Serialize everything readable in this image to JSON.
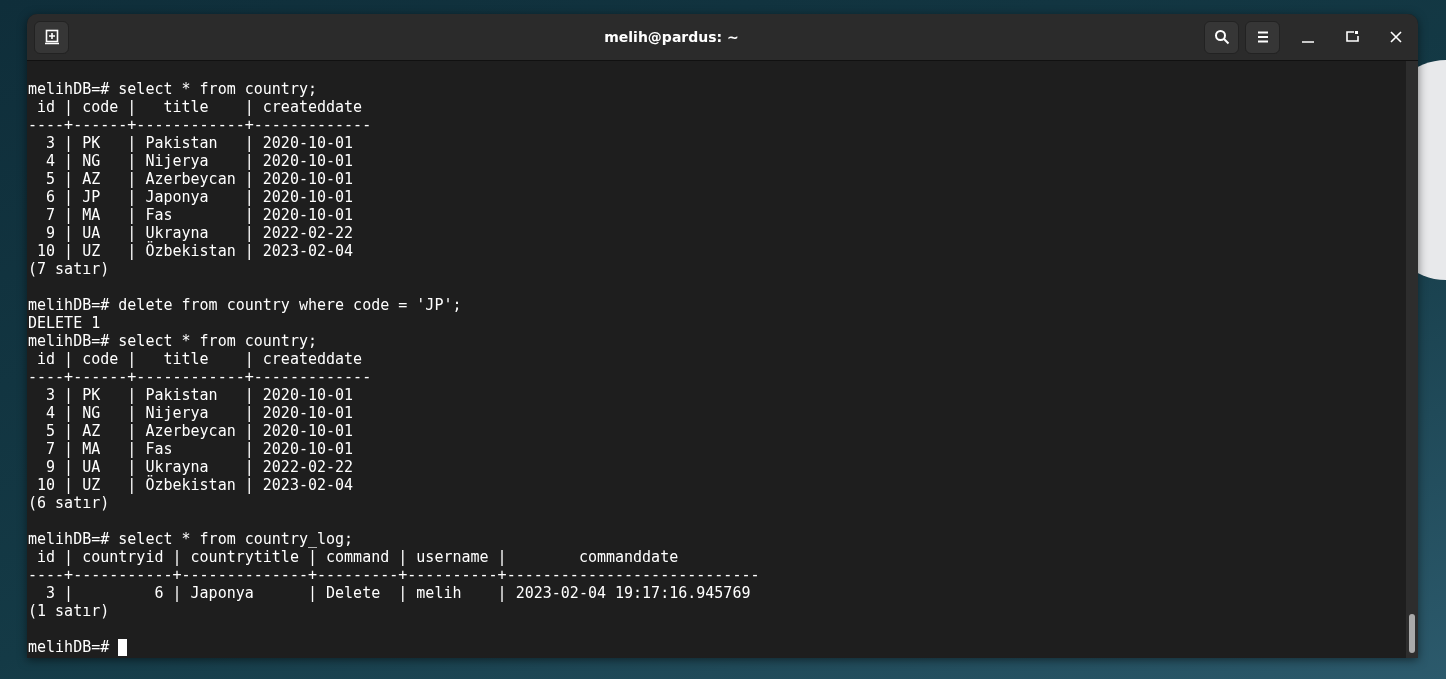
{
  "window": {
    "title": "melih@pardus: ~"
  },
  "terminal": {
    "blocks": [
      [
        "melihDB=# select * from country;",
        " id | code |   title    | createddate",
        "----+------+------------+-------------",
        "  3 | PK   | Pakistan   | 2020-10-01",
        "  4 | NG   | Nijerya    | 2020-10-01",
        "  5 | AZ   | Azerbeycan | 2020-10-01",
        "  6 | JP   | Japonya    | 2020-10-01",
        "  7 | MA   | Fas        | 2020-10-01",
        "  9 | UA   | Ukrayna    | 2022-02-22",
        " 10 | UZ   | Özbekistan | 2023-02-04",
        "(7 satır)"
      ],
      [
        "melihDB=# delete from country where code = 'JP';",
        "DELETE 1",
        "melihDB=# select * from country;",
        " id | code |   title    | createddate",
        "----+------+------------+-------------",
        "  3 | PK   | Pakistan   | 2020-10-01",
        "  4 | NG   | Nijerya    | 2020-10-01",
        "  5 | AZ   | Azerbeycan | 2020-10-01",
        "  7 | MA   | Fas        | 2020-10-01",
        "  9 | UA   | Ukrayna    | 2022-02-22",
        " 10 | UZ   | Özbekistan | 2023-02-04",
        "(6 satır)"
      ],
      [
        "melihDB=# select * from country_log;",
        " id | countryid | countrytitle | command | username |        commanddate",
        "----+-----------+--------------+---------+----------+----------------------------",
        "  3 |         6 | Japonya      | Delete  | melih    | 2023-02-04 19:17:16.945769",
        "(1 satır)"
      ]
    ],
    "prompt": "melihDB=#"
  }
}
